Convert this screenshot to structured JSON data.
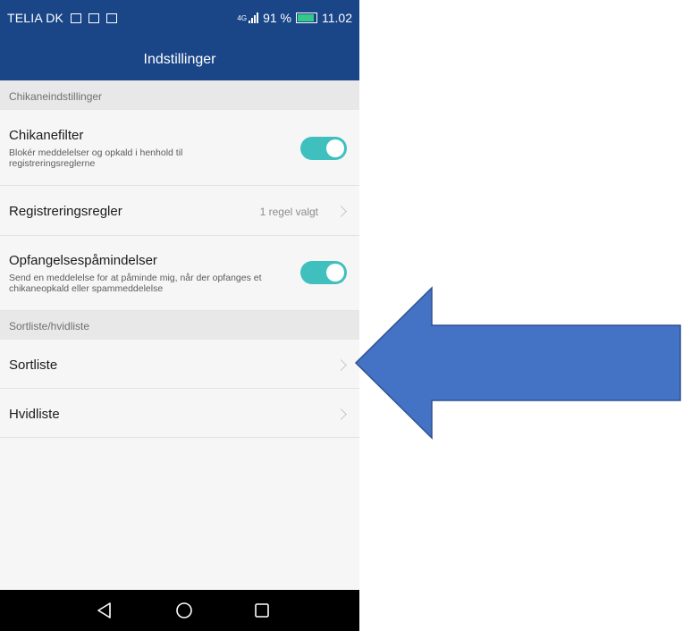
{
  "status_bar": {
    "carrier": "TELIA DK",
    "network": "4G",
    "battery": "91 %",
    "time": "11.02"
  },
  "app_bar": {
    "title": "Indstillinger"
  },
  "sections": {
    "harassment_header": "Chikaneindstillinger",
    "blacklist_header": "Sortliste/hvidliste"
  },
  "rows": {
    "harassment_filter": {
      "title": "Chikanefilter",
      "subtitle": "Blokér meddelelser og opkald i henhold til registreringsreglerne",
      "toggle": true
    },
    "registration_rules": {
      "title": "Registreringsregler",
      "value": "1 regel valgt"
    },
    "intercept_notifications": {
      "title": "Opfangelsespåmindelser",
      "subtitle": "Send en meddelelse for at påminde mig, når der opfanges et chikaneopkald eller spammeddelelse",
      "toggle": true
    },
    "blacklist": {
      "title": "Sortliste"
    },
    "whitelist": {
      "title": "Hvidliste"
    }
  },
  "icons": {
    "nav_back": "back-triangle-icon",
    "nav_home": "home-circle-icon",
    "nav_recent": "recent-square-icon",
    "pointer": "left-arrow-icon"
  },
  "colors": {
    "app_bar": "#1a4688",
    "toggle_on": "#3fc0be",
    "arrow_fill": "#4472c4",
    "arrow_stroke": "#2f528f"
  }
}
